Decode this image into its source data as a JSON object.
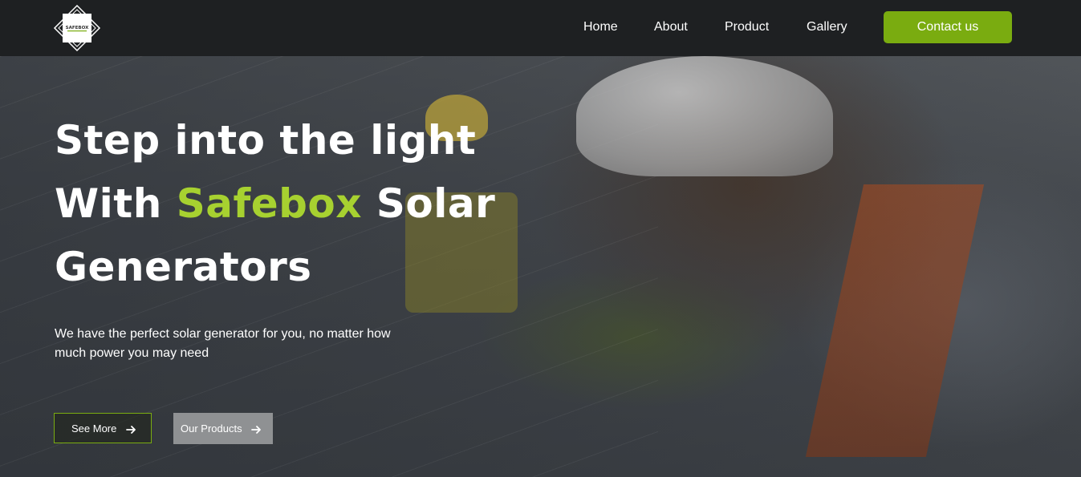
{
  "brand": {
    "logo_text": "SAFEBOX",
    "accent_color": "#7aac10",
    "highlight_color": "#a7d130",
    "nav_bg": "#1e2022"
  },
  "nav": {
    "items": [
      {
        "label": "Home"
      },
      {
        "label": "About"
      },
      {
        "label": "Product"
      },
      {
        "label": "Gallery"
      }
    ],
    "cta_label": "Contact us"
  },
  "hero": {
    "title_line1": "Step into the light",
    "title_line2_prefix": "With ",
    "title_line2_highlight": "Safebox",
    "title_line2_suffix": " Solar",
    "title_line3": "Generators",
    "subtitle": "We have the perfect solar generator for you, no matter how much power you may need",
    "buttons": {
      "see_more": "See More",
      "our_products": "Our Products",
      "arrow_icon": "arrow-right-icon"
    },
    "background_image": "solar-workers-photo"
  }
}
